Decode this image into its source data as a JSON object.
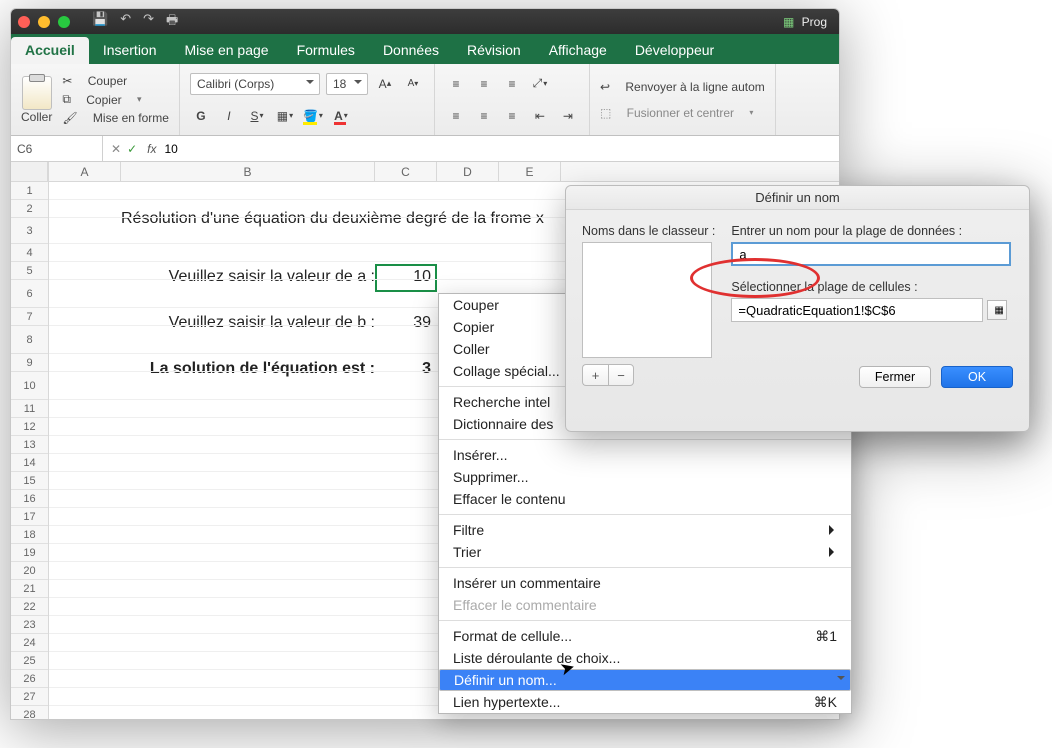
{
  "titlebar": {
    "docname": "Prog"
  },
  "tabs": {
    "accueil": "Accueil",
    "insertion": "Insertion",
    "miseenpage": "Mise en page",
    "formules": "Formules",
    "donnees": "Données",
    "revision": "Révision",
    "affichage": "Affichage",
    "developpeur": "Développeur"
  },
  "clipboard": {
    "paste": "Coller",
    "cut": "Couper",
    "copy": "Copier",
    "format": "Mise en forme"
  },
  "font": {
    "name": "Calibri (Corps)",
    "size": "18",
    "bold": "G",
    "italic": "I",
    "underline": "S",
    "grow": "A",
    "shrink": "A"
  },
  "align": {
    "wrap": "Renvoyer à la ligne autom",
    "merge": "Fusionner et centrer"
  },
  "formulabar": {
    "cell": "C6",
    "value": "10",
    "fx": "fx"
  },
  "columns": [
    "A",
    "B",
    "C",
    "D",
    "E"
  ],
  "sheet": {
    "title": "Résolution d'une équation du deuxième degré de la frome x",
    "label_a": "Veuillez saisir la valeur de a :",
    "value_a": "10",
    "label_b": "Veuillez saisir la valeur de b :",
    "value_b": "39",
    "label_sol": "La solution de l'équation est :",
    "value_sol": "3"
  },
  "context": {
    "cut": "Couper",
    "copy": "Copier",
    "paste": "Coller",
    "paste_special": "Collage spécial...",
    "smart": "Recherche intel",
    "dict": "Dictionnaire des",
    "insert": "Insérer...",
    "delete": "Supprimer...",
    "clear": "Effacer le contenu",
    "filter": "Filtre",
    "sort": "Trier",
    "comment_add": "Insérer un commentaire",
    "comment_clear": "Effacer le commentaire",
    "format": "Format de cellule...",
    "format_sc": "⌘1",
    "dropdown": "Liste déroulante de choix...",
    "define": "Définir un nom...",
    "hyperlink": "Lien hypertexte...",
    "hyperlink_sc": "⌘K"
  },
  "dialog": {
    "title": "Définir un nom",
    "names_label": "Noms dans le classeur :",
    "name_field_label": "Entrer un nom pour la plage de données :",
    "name_value": "a",
    "range_label": "Sélectionner la plage de cellules :",
    "range_value": "=QuadraticEquation1!$C$6",
    "close": "Fermer",
    "ok": "OK",
    "plus": "+",
    "minus": "−"
  }
}
